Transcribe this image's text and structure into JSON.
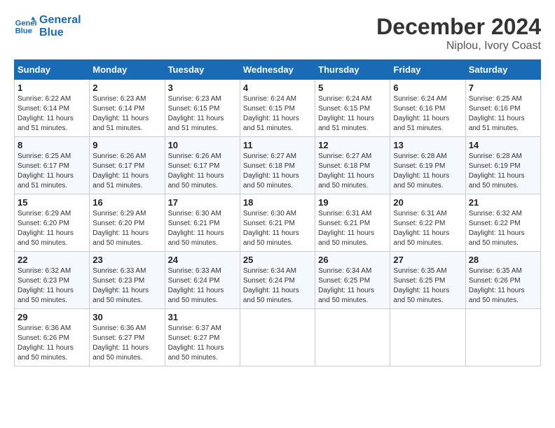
{
  "header": {
    "logo_line1": "General",
    "logo_line2": "Blue",
    "month": "December 2024",
    "location": "Niplou, Ivory Coast"
  },
  "days_of_week": [
    "Sunday",
    "Monday",
    "Tuesday",
    "Wednesday",
    "Thursday",
    "Friday",
    "Saturday"
  ],
  "weeks": [
    [
      {
        "day": "1",
        "info": "Sunrise: 6:22 AM\nSunset: 6:14 PM\nDaylight: 11 hours\nand 51 minutes."
      },
      {
        "day": "2",
        "info": "Sunrise: 6:23 AM\nSunset: 6:14 PM\nDaylight: 11 hours\nand 51 minutes."
      },
      {
        "day": "3",
        "info": "Sunrise: 6:23 AM\nSunset: 6:15 PM\nDaylight: 11 hours\nand 51 minutes."
      },
      {
        "day": "4",
        "info": "Sunrise: 6:24 AM\nSunset: 6:15 PM\nDaylight: 11 hours\nand 51 minutes."
      },
      {
        "day": "5",
        "info": "Sunrise: 6:24 AM\nSunset: 6:15 PM\nDaylight: 11 hours\nand 51 minutes."
      },
      {
        "day": "6",
        "info": "Sunrise: 6:24 AM\nSunset: 6:16 PM\nDaylight: 11 hours\nand 51 minutes."
      },
      {
        "day": "7",
        "info": "Sunrise: 6:25 AM\nSunset: 6:16 PM\nDaylight: 11 hours\nand 51 minutes."
      }
    ],
    [
      {
        "day": "8",
        "info": "Sunrise: 6:25 AM\nSunset: 6:17 PM\nDaylight: 11 hours\nand 51 minutes."
      },
      {
        "day": "9",
        "info": "Sunrise: 6:26 AM\nSunset: 6:17 PM\nDaylight: 11 hours\nand 51 minutes."
      },
      {
        "day": "10",
        "info": "Sunrise: 6:26 AM\nSunset: 6:17 PM\nDaylight: 11 hours\nand 50 minutes."
      },
      {
        "day": "11",
        "info": "Sunrise: 6:27 AM\nSunset: 6:18 PM\nDaylight: 11 hours\nand 50 minutes."
      },
      {
        "day": "12",
        "info": "Sunrise: 6:27 AM\nSunset: 6:18 PM\nDaylight: 11 hours\nand 50 minutes."
      },
      {
        "day": "13",
        "info": "Sunrise: 6:28 AM\nSunset: 6:19 PM\nDaylight: 11 hours\nand 50 minutes."
      },
      {
        "day": "14",
        "info": "Sunrise: 6:28 AM\nSunset: 6:19 PM\nDaylight: 11 hours\nand 50 minutes."
      }
    ],
    [
      {
        "day": "15",
        "info": "Sunrise: 6:29 AM\nSunset: 6:20 PM\nDaylight: 11 hours\nand 50 minutes."
      },
      {
        "day": "16",
        "info": "Sunrise: 6:29 AM\nSunset: 6:20 PM\nDaylight: 11 hours\nand 50 minutes."
      },
      {
        "day": "17",
        "info": "Sunrise: 6:30 AM\nSunset: 6:21 PM\nDaylight: 11 hours\nand 50 minutes."
      },
      {
        "day": "18",
        "info": "Sunrise: 6:30 AM\nSunset: 6:21 PM\nDaylight: 11 hours\nand 50 minutes."
      },
      {
        "day": "19",
        "info": "Sunrise: 6:31 AM\nSunset: 6:21 PM\nDaylight: 11 hours\nand 50 minutes."
      },
      {
        "day": "20",
        "info": "Sunrise: 6:31 AM\nSunset: 6:22 PM\nDaylight: 11 hours\nand 50 minutes."
      },
      {
        "day": "21",
        "info": "Sunrise: 6:32 AM\nSunset: 6:22 PM\nDaylight: 11 hours\nand 50 minutes."
      }
    ],
    [
      {
        "day": "22",
        "info": "Sunrise: 6:32 AM\nSunset: 6:23 PM\nDaylight: 11 hours\nand 50 minutes."
      },
      {
        "day": "23",
        "info": "Sunrise: 6:33 AM\nSunset: 6:23 PM\nDaylight: 11 hours\nand 50 minutes."
      },
      {
        "day": "24",
        "info": "Sunrise: 6:33 AM\nSunset: 6:24 PM\nDaylight: 11 hours\nand 50 minutes."
      },
      {
        "day": "25",
        "info": "Sunrise: 6:34 AM\nSunset: 6:24 PM\nDaylight: 11 hours\nand 50 minutes."
      },
      {
        "day": "26",
        "info": "Sunrise: 6:34 AM\nSunset: 6:25 PM\nDaylight: 11 hours\nand 50 minutes."
      },
      {
        "day": "27",
        "info": "Sunrise: 6:35 AM\nSunset: 6:25 PM\nDaylight: 11 hours\nand 50 minutes."
      },
      {
        "day": "28",
        "info": "Sunrise: 6:35 AM\nSunset: 6:26 PM\nDaylight: 11 hours\nand 50 minutes."
      }
    ],
    [
      {
        "day": "29",
        "info": "Sunrise: 6:36 AM\nSunset: 6:26 PM\nDaylight: 11 hours\nand 50 minutes."
      },
      {
        "day": "30",
        "info": "Sunrise: 6:36 AM\nSunset: 6:27 PM\nDaylight: 11 hours\nand 50 minutes."
      },
      {
        "day": "31",
        "info": "Sunrise: 6:37 AM\nSunset: 6:27 PM\nDaylight: 11 hours\nand 50 minutes."
      },
      null,
      null,
      null,
      null
    ]
  ]
}
